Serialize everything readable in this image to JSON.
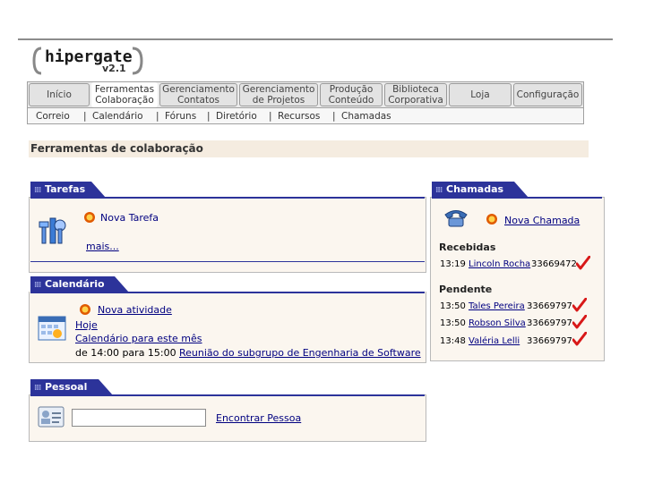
{
  "logo": {
    "name": "hipergate",
    "version": "v2.1"
  },
  "menu": [
    {
      "label": "Início"
    },
    {
      "label": "Ferramentas\nColaboração"
    },
    {
      "label": "Gerenciamento\nContatos"
    },
    {
      "label": "Gerenciamento\nde Projetos"
    },
    {
      "label": "Produção\nConteúdo"
    },
    {
      "label": "Biblioteca\nCorporativa"
    },
    {
      "label": "Loja"
    },
    {
      "label": "Configuração"
    }
  ],
  "submenu": [
    "Correio",
    "Calendário",
    "Fóruns",
    "Diretório",
    "Recursos",
    "Chamadas"
  ],
  "page_title": "Ferramentas de colaboração",
  "tasks": {
    "tab": "Tarefas",
    "new_label": "Nova Tarefa",
    "more_label": "mais..."
  },
  "calendar": {
    "tab": "Calendário",
    "new_label": "Nova atividade",
    "today_label": "Hoje",
    "month_label": "Calendário para este mês",
    "event_time": "de 14:00 para 15:00",
    "event_title": "Reunião do subgrupo de Engenharia de Software"
  },
  "personal": {
    "tab": "Pessoal",
    "search_value": "",
    "find_label": "Encontrar Pessoa"
  },
  "calls": {
    "tab": "Chamadas",
    "new_label": "Nova Chamada",
    "received_heading": "Recebidas",
    "received": [
      {
        "time": "13:19",
        "name": "Lincoln Rocha",
        "number": "33669472"
      }
    ],
    "pending_heading": "Pendente",
    "pending": [
      {
        "time": "13:50",
        "name": "Tales Pereira",
        "number": "33669797"
      },
      {
        "time": "13:50",
        "name": "Robson Silva",
        "number": "33669797"
      },
      {
        "time": "13:48",
        "name": "Valéria Lelli",
        "number": "33669797"
      }
    ]
  },
  "colors": {
    "tab_blue": "#2c339a",
    "panel_bg": "#fbf6ef",
    "title_bg": "#f5ece0",
    "check_red": "#d81818"
  }
}
